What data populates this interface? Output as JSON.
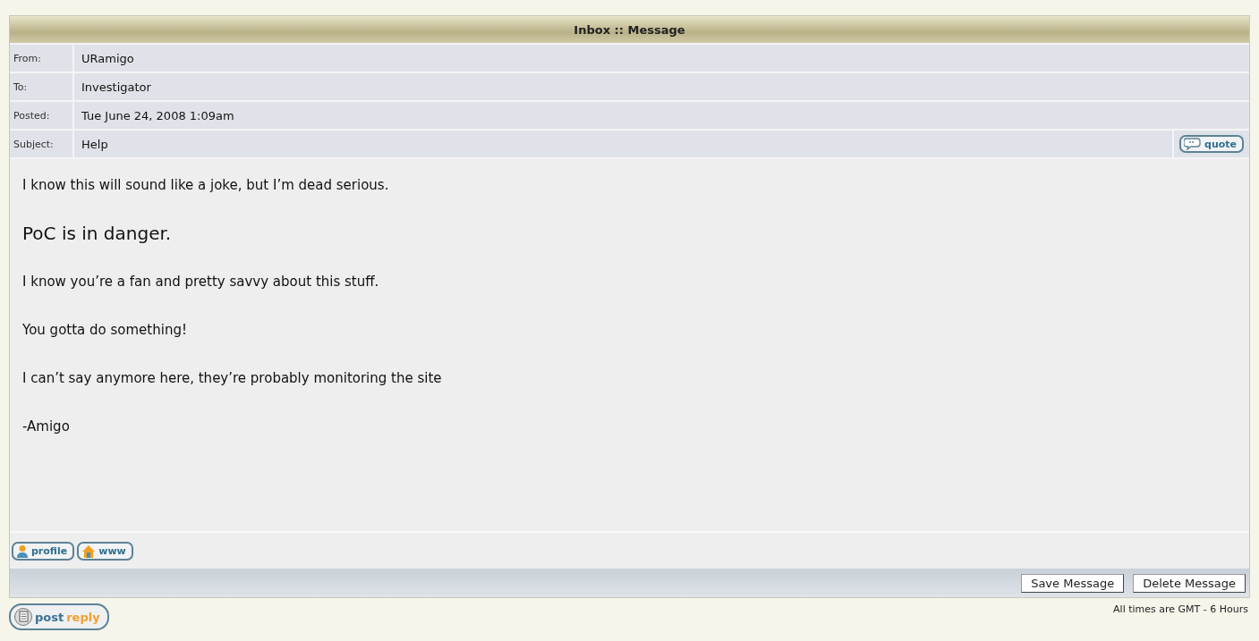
{
  "panel": {
    "title": "Inbox :: Message"
  },
  "fields": [
    {
      "label": "From:",
      "value": "URamigo"
    },
    {
      "label": "To:",
      "value": "Investigator"
    },
    {
      "label": "Posted:",
      "value": "Tue June 24, 2008  1:09am"
    },
    {
      "label": "Subject:",
      "value": "Help"
    }
  ],
  "quote_button": {
    "label": "quote"
  },
  "body": [
    {
      "kind": "normal",
      "text": "I know this will sound like a joke, but I’m dead serious."
    },
    {
      "kind": "large",
      "text": "PoC is in danger."
    },
    {
      "kind": "normal",
      "text": "I know you’re a fan and pretty savvy about this stuff."
    },
    {
      "kind": "normal",
      "text": "You gotta do something!"
    },
    {
      "kind": "normal",
      "text": "I can’t say anymore here, they’re probably monitoring the site"
    },
    {
      "kind": "normal",
      "text": "-Amigo"
    }
  ],
  "profile_links": [
    {
      "kind": "profile",
      "label": "profile"
    },
    {
      "kind": "www",
      "label": "www"
    }
  ],
  "actions": [
    "Save Message",
    "Delete Message"
  ],
  "post_reply": {
    "label_start": "post",
    "label_end": "reply"
  },
  "timezone_note": "All times are GMT - 6 Hours"
}
